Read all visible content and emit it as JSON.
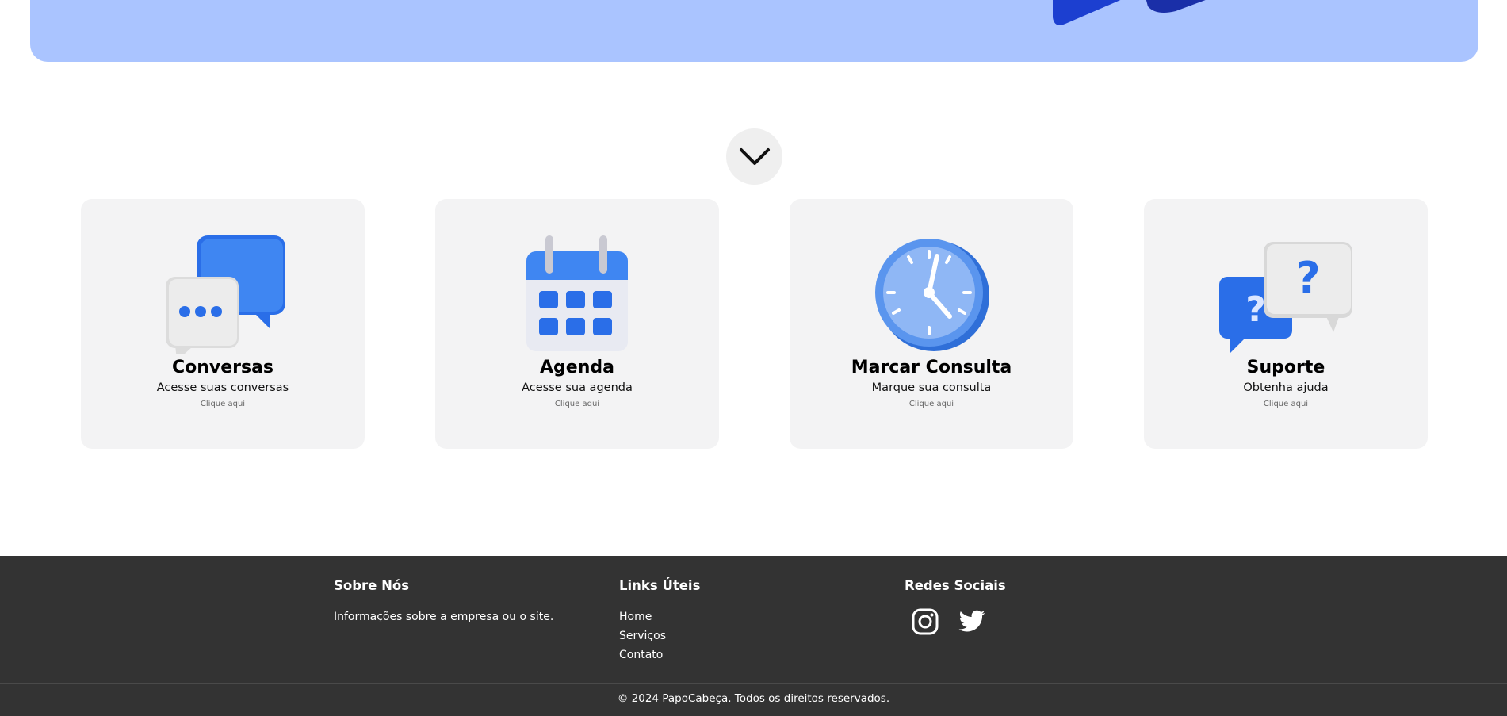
{
  "colors": {
    "hero_background": "#aac4ff",
    "card_background": "#f3f3f4",
    "footer_background": "#333333",
    "accent_blue": "#2a6ee8"
  },
  "cards": [
    {
      "title": "Conversas",
      "description": "Acesse suas conversas",
      "link": "Clique aqui",
      "icon": "chat-bubbles-icon"
    },
    {
      "title": "Agenda",
      "description": "Acesse sua agenda",
      "link": "Clique aqui",
      "icon": "calendar-icon"
    },
    {
      "title": "Marcar Consulta",
      "description": "Marque sua consulta",
      "link": "Clique aqui",
      "icon": "clock-icon"
    },
    {
      "title": "Suporte",
      "description": "Obtenha ajuda",
      "link": "Clique aqui",
      "icon": "question-bubbles-icon"
    }
  ],
  "scroll_button": {
    "icon": "chevron-down-icon"
  },
  "footer": {
    "about": {
      "title": "Sobre Nós",
      "text": "Informações sobre a empresa ou o site."
    },
    "links": {
      "title": "Links Úteis",
      "items": [
        "Home",
        "Serviços",
        "Contato"
      ]
    },
    "social": {
      "title": "Redes Sociais",
      "icons": [
        "instagram-icon",
        "twitter-icon"
      ]
    },
    "copyright": "© 2024 PapoCabeça. Todos os direitos reservados."
  }
}
